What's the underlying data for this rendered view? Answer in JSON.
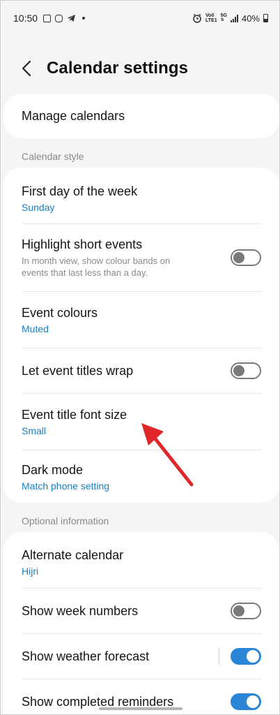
{
  "status_bar": {
    "time": "10:50",
    "network_top": "Vo0",
    "network_bottom": "LTE1",
    "network_gen": "5G",
    "battery": "40%"
  },
  "header": {
    "title": "Calendar settings",
    "back_icon": "chevron-left-icon"
  },
  "manage": {
    "label": "Manage calendars"
  },
  "sections": {
    "style_title": "Calendar style",
    "optional_title": "Optional information"
  },
  "style": {
    "first_day": {
      "label": "First day of the week",
      "value": "Sunday"
    },
    "highlight": {
      "label": "Highlight short events",
      "desc": "In month view, show colour bands on events that last less than a day.",
      "enabled": false
    },
    "colours": {
      "label": "Event colours",
      "value": "Muted"
    },
    "wrap": {
      "label": "Let event titles wrap",
      "enabled": false
    },
    "font_size": {
      "label": "Event title font size",
      "value": "Small"
    },
    "dark_mode": {
      "label": "Dark mode",
      "value": "Match phone setting"
    }
  },
  "optional": {
    "alternate": {
      "label": "Alternate calendar",
      "value": "Hijri"
    },
    "week_numbers": {
      "label": "Show week numbers",
      "enabled": false
    },
    "weather": {
      "label": "Show weather forecast",
      "enabled": true
    },
    "completed": {
      "label": "Show completed reminders",
      "enabled": true
    }
  },
  "colors": {
    "accent": "#2a84d8",
    "link": "#1a7fbf",
    "annotation_arrow": "#e0262b"
  }
}
